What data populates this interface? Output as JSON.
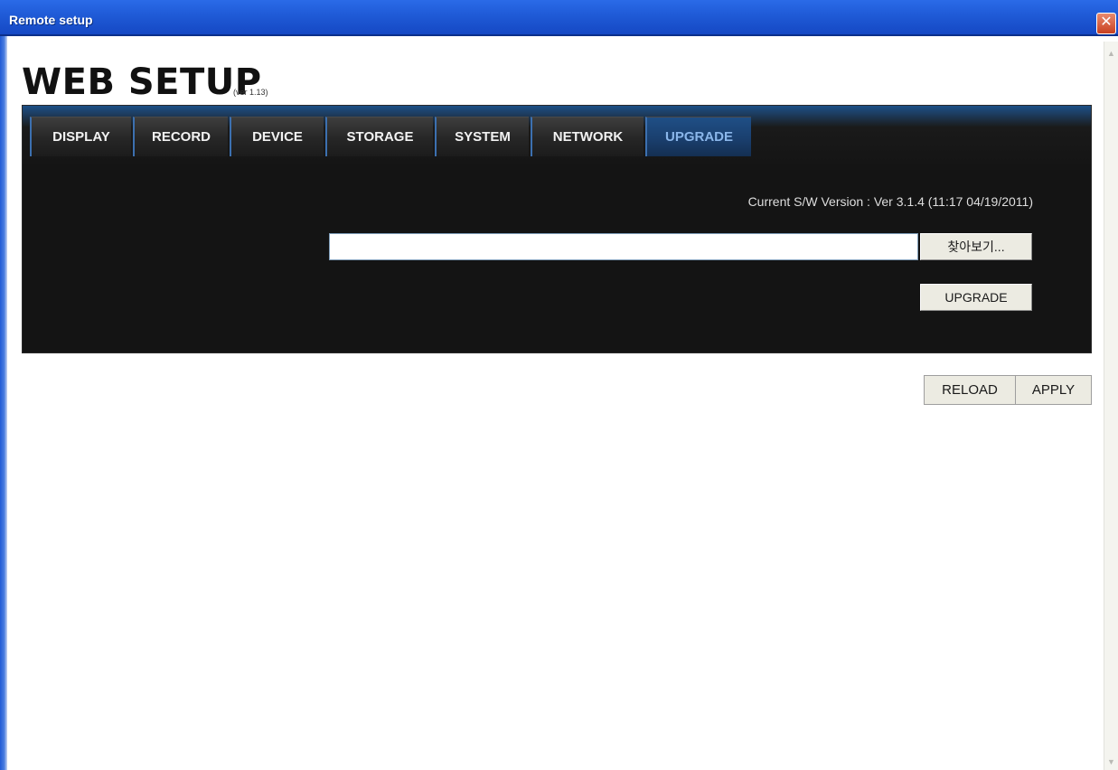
{
  "window": {
    "title": "Remote setup",
    "close_icon": "close-icon",
    "scroll_up_icon": "scroll-up-arrow-icon",
    "scroll_down_icon": "scroll-down-arrow-icon"
  },
  "header": {
    "title": "WEB SETUP",
    "version": "(ver 1.13)"
  },
  "tabs": [
    {
      "label": "DISPLAY",
      "active": false
    },
    {
      "label": "RECORD",
      "active": false
    },
    {
      "label": "DEVICE",
      "active": false
    },
    {
      "label": "STORAGE",
      "active": false
    },
    {
      "label": "SYSTEM",
      "active": false
    },
    {
      "label": "NETWORK",
      "active": false
    },
    {
      "label": "UPGRADE",
      "active": true
    }
  ],
  "upgrade": {
    "current_version": "Current S/W Version : Ver 3.1.4 (11:17 04/19/2011)",
    "file_value": "",
    "browse_label": "찾아보기...",
    "upgrade_label": "UPGRADE"
  },
  "footer": {
    "reload_label": "RELOAD",
    "apply_label": "APPLY"
  },
  "colors": {
    "title_bar": "#1f5ad6",
    "panel_bg": "#141414",
    "active_tab_text": "#8ab6ea",
    "button_face": "#ecebe2"
  }
}
